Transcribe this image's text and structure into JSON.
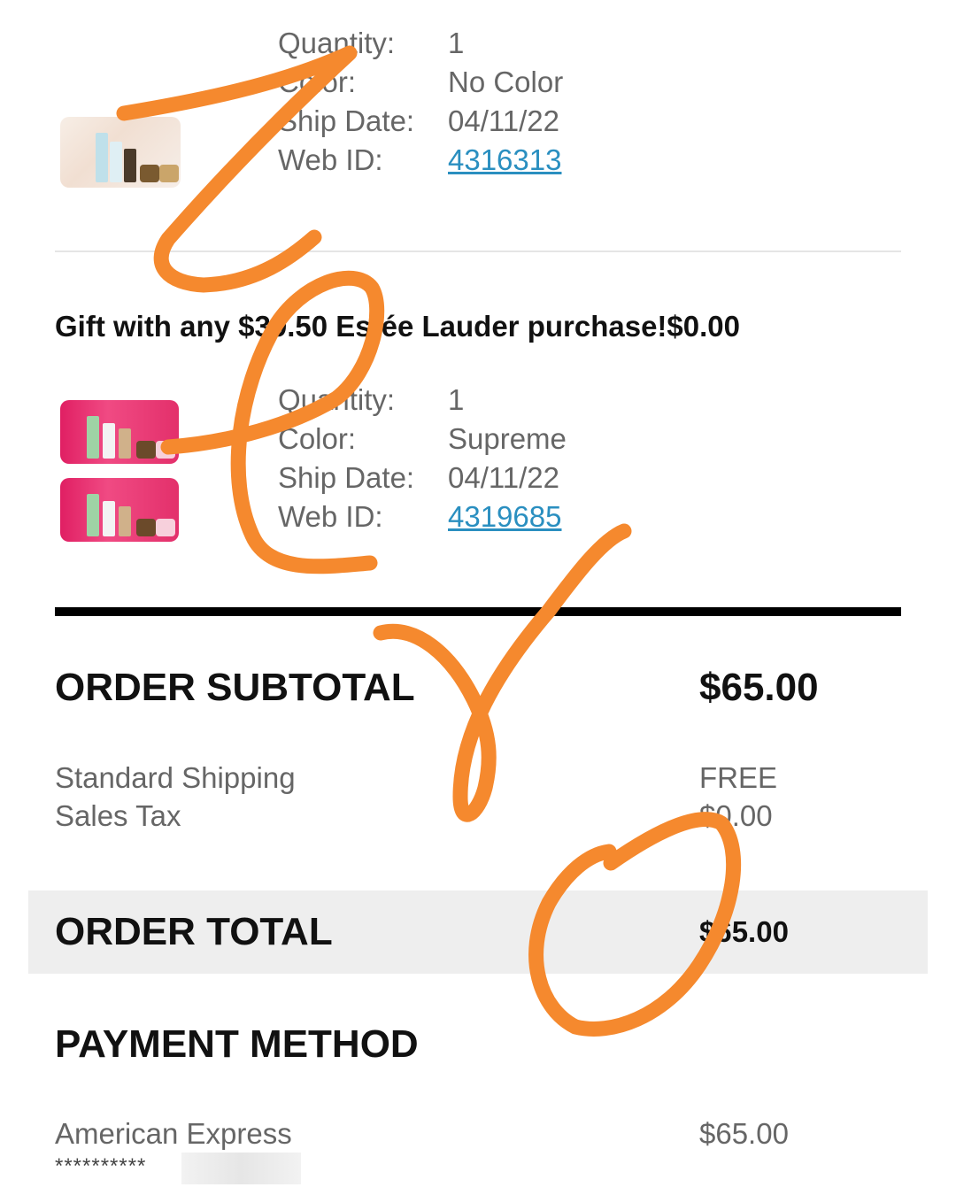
{
  "item1": {
    "quantity_label": "Quantity:",
    "quantity_value": "1",
    "color_label": "Color:",
    "color_value": "No Color",
    "ship_label": "Ship Date:",
    "ship_value": "04/11/22",
    "webid_label": "Web ID:",
    "webid_value": "4316313"
  },
  "gift": {
    "title": "Gift with any $39.50 Estée Lauder purchase!",
    "price": "$0.00"
  },
  "item2": {
    "quantity_label": "Quantity:",
    "quantity_value": "1",
    "color_label": "Color:",
    "color_value": "Supreme",
    "ship_label": "Ship Date:",
    "ship_value": "04/11/22",
    "webid_label": "Web ID:",
    "webid_value": "4319685"
  },
  "summary": {
    "subtotal_label": "ORDER SUBTOTAL",
    "subtotal_value": "$65.00",
    "shipping_label": "Standard Shipping",
    "shipping_value": "FREE",
    "tax_label": "Sales Tax",
    "tax_value": "$0.00",
    "total_label": "ORDER TOTAL",
    "total_value": "$65.00"
  },
  "payment": {
    "title": "PAYMENT METHOD",
    "method": "American Express",
    "amount": "$65.00",
    "masked": "**********"
  },
  "colors": {
    "link": "#2a8fc0",
    "scribble": "#f5892e",
    "band": "#eeeeee"
  }
}
